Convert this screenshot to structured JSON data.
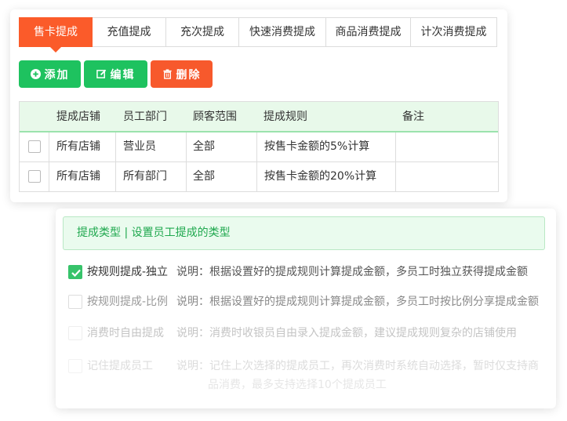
{
  "tabs": [
    {
      "label": "售卡提成",
      "active": true
    },
    {
      "label": "充值提成",
      "active": false
    },
    {
      "label": "充次提成",
      "active": false
    },
    {
      "label": "快速消费提成",
      "active": false
    },
    {
      "label": "商品消费提成",
      "active": false
    },
    {
      "label": "计次消费提成",
      "active": false
    }
  ],
  "toolbar": {
    "add_label": "添加",
    "edit_label": "编辑",
    "delete_label": "删除",
    "add_icon": "plus-circle-icon",
    "edit_icon": "edit-icon",
    "delete_icon": "trash-icon"
  },
  "table": {
    "headers": [
      "提成店铺",
      "员工部门",
      "顾客范围",
      "提成规则",
      "备注"
    ],
    "rows": [
      {
        "store": "所有店铺",
        "dept": "营业员",
        "scope": "全部",
        "rule": "按售卡金额的5%计算",
        "note": ""
      },
      {
        "store": "所有店铺",
        "dept": "所有部门",
        "scope": "全部",
        "rule": "按售卡金额的20%计算",
        "note": ""
      }
    ]
  },
  "commission_type": {
    "hint": "提成类型 | 设置员工提成的类型",
    "options": [
      {
        "label": "按规则提成-独立",
        "desc": "说明：根据设置好的提成规则计算提成金额，多员工时独立获得提成金额",
        "checked": true
      },
      {
        "label": "按规则提成-比例",
        "desc": "说明：根据设置好的提成规则计算提成金额，多员工时按比例分享提成金额",
        "checked": false
      },
      {
        "label": "消费时自由提成",
        "desc": "说明：消费时收银员自由录入提成金额，建议提成规则复杂的店铺使用",
        "checked": false
      },
      {
        "label": "记住提成员工",
        "desc": "说明：记住上次选择的提成员工，再次消费时系统自动选择，暂时仅支持商",
        "desc2": "品消费，最多支持选择10个提成员工",
        "checked": false
      }
    ]
  },
  "colors": {
    "accent": "#fb5b2a",
    "green": "#1ec25f",
    "danger": "#f7592c"
  }
}
